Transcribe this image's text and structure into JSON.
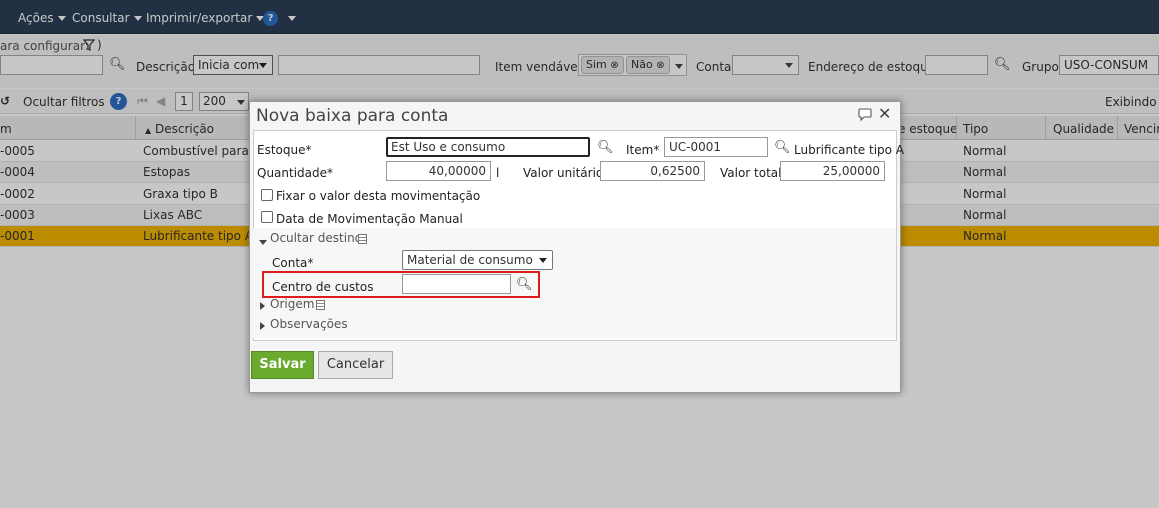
{
  "menubar": {
    "acoes": "Ações",
    "consultar": "Consultar",
    "imprimir": "Imprimir/exportar",
    "help": "?"
  },
  "filters": {
    "config_label": "ara configurar:",
    "descricao_label": "Descrição",
    "descricao_mode": "Inicia com",
    "item_vendavel_label": "Item vendável",
    "sim_chip": "Sim",
    "nao_chip": "Não",
    "conta_label": "Conta",
    "endereco_label": "Endereço de estoque",
    "grupo_label": "Grupo",
    "grupo_value": "USO-CONSUM"
  },
  "toolbar": {
    "ocultar_filtros": "Ocultar filtros",
    "page": "1",
    "page_size": "200",
    "exibindo": "Exibindo it"
  },
  "grid": {
    "headers": {
      "codigo": "m",
      "descricao": "Descrição",
      "estoque": "e estoque",
      "tipo": "Tipo",
      "qualidade": "Qualidade",
      "vencimento": "Vencim"
    },
    "rows": [
      {
        "codigo": "-0005",
        "descricao": "Combustível para m",
        "tipo": "Normal"
      },
      {
        "codigo": "-0004",
        "descricao": "Estopas",
        "tipo": "Normal"
      },
      {
        "codigo": "-0002",
        "descricao": "Graxa tipo B",
        "tipo": "Normal"
      },
      {
        "codigo": "-0003",
        "descricao": "Lixas ABC",
        "tipo": "Normal"
      },
      {
        "codigo": "-0001",
        "descricao": "Lubrificante tipo A",
        "tipo": "Normal"
      }
    ]
  },
  "modal": {
    "title": "Nova baixa para conta",
    "estoque_label": "Estoque*",
    "estoque_value": "Est Uso e consumo",
    "item_label": "Item*",
    "item_value": "UC-0001",
    "item_desc": "Lubrificante tipo A",
    "quantidade_label": "Quantidade*",
    "quantidade_value": "40,00000",
    "unidade": "l",
    "valor_unitario_label": "Valor unitário",
    "valor_unitario_value": "0,62500",
    "valor_total_label": "Valor total",
    "valor_total_value": "25,00000",
    "fixar_label": "Fixar o valor desta movimentação",
    "data_manual_label": "Data de Movimentação Manual",
    "ocultar_destino": "Ocultar destino",
    "conta_label": "Conta*",
    "conta_value": "Material de consumo",
    "centro_custos_label": "Centro de custos",
    "centro_custos_value": "",
    "origem": "Origem",
    "observacoes": "Observações",
    "salvar": "Salvar",
    "cancelar": "Cancelar"
  },
  "colors": {
    "menubar": "#2c3e57",
    "selected_row": "#f0b400",
    "save_button": "#6aab2f",
    "highlight": "#e01b1b"
  }
}
